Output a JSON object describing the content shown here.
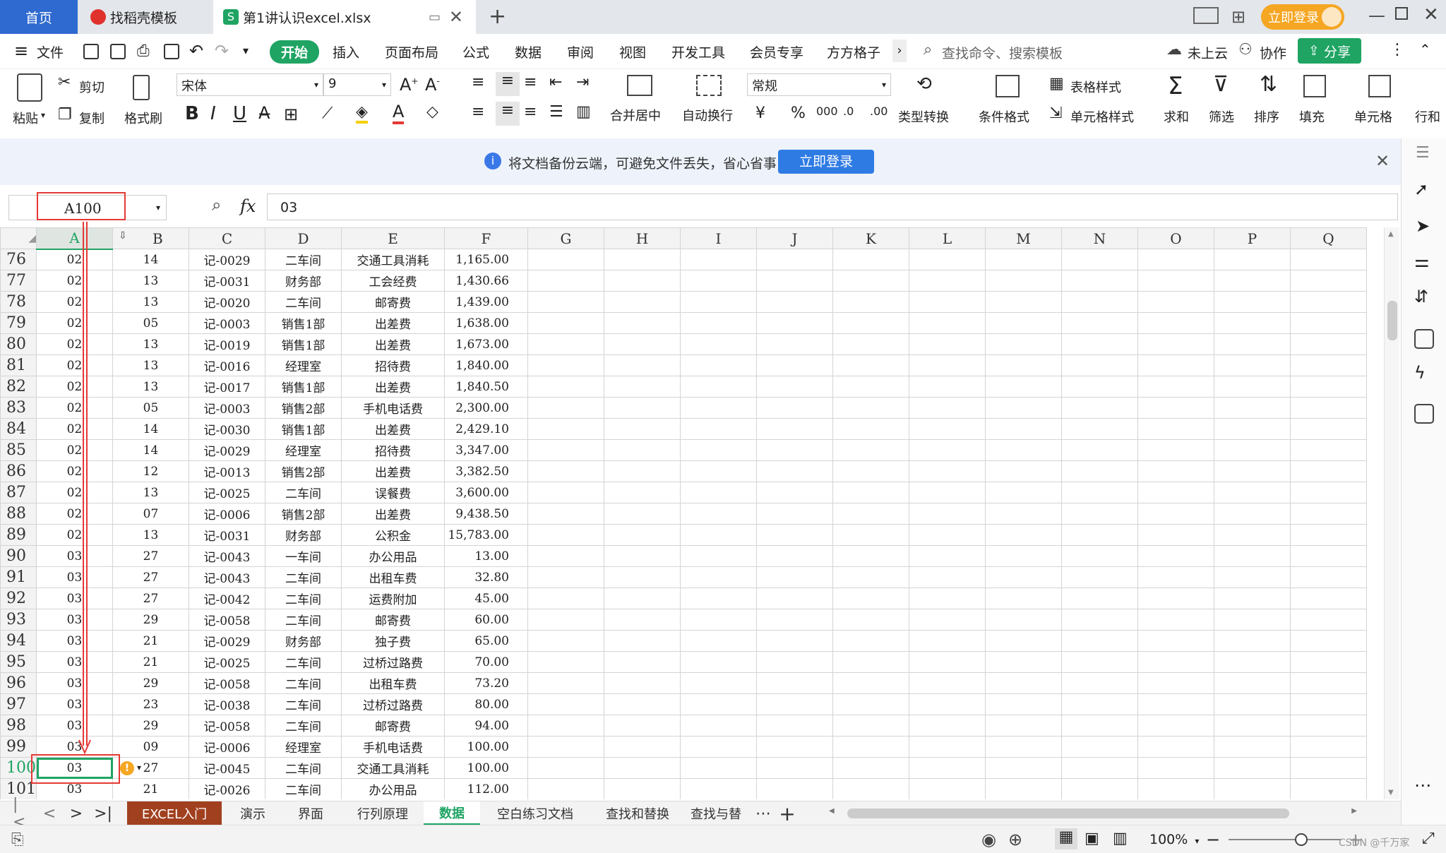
{
  "tabs": {
    "home": "首页",
    "template": "找稻壳模板",
    "file": "第1讲认识excel.xlsx",
    "login": "立即登录"
  },
  "menu": {
    "file": "文件",
    "items": [
      "开始",
      "插入",
      "页面布局",
      "公式",
      "数据",
      "审阅",
      "视图",
      "开发工具",
      "会员专享",
      "方方格子"
    ],
    "search_placeholder": "查找命令、搜索模板",
    "cloud": "未上云",
    "collab": "协作",
    "share": "分享"
  },
  "toolbar": {
    "paste": "粘贴",
    "cut": "剪切",
    "copy": "复制",
    "format_painter": "格式刷",
    "font_name": "宋体",
    "font_size": "9",
    "merge_center": "合并居中",
    "wrap": "自动换行",
    "number_format": "常规",
    "type_convert": "类型转换",
    "cond_format": "条件格式",
    "table_style": "表格样式",
    "cell_style": "单元格样式",
    "sum": "求和",
    "filter": "筛选",
    "sort": "排序",
    "fill": "填充",
    "cell": "单元格",
    "rowcol": "行和"
  },
  "notice": {
    "text": "将文档备份云端，可避免文件丢失，省心省事",
    "button": "立即登录"
  },
  "formula_bar": {
    "name_box": "A100",
    "fx": "fx",
    "value": "03"
  },
  "columns": [
    "A",
    "B",
    "C",
    "D",
    "E",
    "F",
    "G",
    "H",
    "I",
    "J",
    "K",
    "L",
    "M",
    "N",
    "O",
    "P",
    "Q"
  ],
  "rows": [
    {
      "n": "76",
      "a": "02",
      "b": "14",
      "c": "记-0029",
      "d": "二车间",
      "e": "交通工具消耗",
      "f": "1,165.00"
    },
    {
      "n": "77",
      "a": "02",
      "b": "13",
      "c": "记-0031",
      "d": "财务部",
      "e": "工会经费",
      "f": "1,430.66"
    },
    {
      "n": "78",
      "a": "02",
      "b": "13",
      "c": "记-0020",
      "d": "二车间",
      "e": "邮寄费",
      "f": "1,439.00"
    },
    {
      "n": "79",
      "a": "02",
      "b": "05",
      "c": "记-0003",
      "d": "销售1部",
      "e": "出差费",
      "f": "1,638.00"
    },
    {
      "n": "80",
      "a": "02",
      "b": "13",
      "c": "记-0019",
      "d": "销售1部",
      "e": "出差费",
      "f": "1,673.00"
    },
    {
      "n": "81",
      "a": "02",
      "b": "13",
      "c": "记-0016",
      "d": "经理室",
      "e": "招待费",
      "f": "1,840.00"
    },
    {
      "n": "82",
      "a": "02",
      "b": "13",
      "c": "记-0017",
      "d": "销售1部",
      "e": "出差费",
      "f": "1,840.50"
    },
    {
      "n": "83",
      "a": "02",
      "b": "05",
      "c": "记-0003",
      "d": "销售2部",
      "e": "手机电话费",
      "f": "2,300.00"
    },
    {
      "n": "84",
      "a": "02",
      "b": "14",
      "c": "记-0030",
      "d": "销售1部",
      "e": "出差费",
      "f": "2,429.10"
    },
    {
      "n": "85",
      "a": "02",
      "b": "14",
      "c": "记-0029",
      "d": "经理室",
      "e": "招待费",
      "f": "3,347.00"
    },
    {
      "n": "86",
      "a": "02",
      "b": "12",
      "c": "记-0013",
      "d": "销售2部",
      "e": "出差费",
      "f": "3,382.50"
    },
    {
      "n": "87",
      "a": "02",
      "b": "13",
      "c": "记-0025",
      "d": "二车间",
      "e": "误餐费",
      "f": "3,600.00"
    },
    {
      "n": "88",
      "a": "02",
      "b": "07",
      "c": "记-0006",
      "d": "销售2部",
      "e": "出差费",
      "f": "9,438.50"
    },
    {
      "n": "89",
      "a": "02",
      "b": "13",
      "c": "记-0031",
      "d": "财务部",
      "e": "公积金",
      "f": "15,783.00"
    },
    {
      "n": "90",
      "a": "03",
      "b": "27",
      "c": "记-0043",
      "d": "一车间",
      "e": "办公用品",
      "f": "13.00"
    },
    {
      "n": "91",
      "a": "03",
      "b": "27",
      "c": "记-0043",
      "d": "二车间",
      "e": "出租车费",
      "f": "32.80"
    },
    {
      "n": "92",
      "a": "03",
      "b": "27",
      "c": "记-0042",
      "d": "二车间",
      "e": "运费附加",
      "f": "45.00"
    },
    {
      "n": "93",
      "a": "03",
      "b": "29",
      "c": "记-0058",
      "d": "二车间",
      "e": "邮寄费",
      "f": "60.00"
    },
    {
      "n": "94",
      "a": "03",
      "b": "21",
      "c": "记-0029",
      "d": "财务部",
      "e": "独子费",
      "f": "65.00"
    },
    {
      "n": "95",
      "a": "03",
      "b": "21",
      "c": "记-0025",
      "d": "二车间",
      "e": "过桥过路费",
      "f": "70.00"
    },
    {
      "n": "96",
      "a": "03",
      "b": "29",
      "c": "记-0058",
      "d": "二车间",
      "e": "出租车费",
      "f": "73.20"
    },
    {
      "n": "97",
      "a": "03",
      "b": "23",
      "c": "记-0038",
      "d": "二车间",
      "e": "过桥过路费",
      "f": "80.00"
    },
    {
      "n": "98",
      "a": "03",
      "b": "29",
      "c": "记-0058",
      "d": "二车间",
      "e": "邮寄费",
      "f": "94.00"
    },
    {
      "n": "99",
      "a": "03",
      "b": "09",
      "c": "记-0006",
      "d": "经理室",
      "e": "手机电话费",
      "f": "100.00"
    },
    {
      "n": "100",
      "a": "03",
      "b": "27",
      "c": "记-0045",
      "d": "二车间",
      "e": "交通工具消耗",
      "f": "100.00"
    },
    {
      "n": "101",
      "a": "03",
      "b": "21",
      "c": "记-0026",
      "d": "二车间",
      "e": "办公用品",
      "f": "112.00"
    }
  ],
  "sheet_tabs": [
    "EXCEL入门",
    "演示",
    "界面",
    "行列原理",
    "数据",
    "空白练习文档",
    "查找和替换",
    "查找与替"
  ],
  "active_sheet": "数据",
  "status": {
    "zoom": "100%",
    "watermark": "CSDN @千万家"
  },
  "colors": {
    "accent": "#1fa463",
    "home_tab": "#2f6ad0",
    "login_btn": "#f5a623",
    "first_sheet_tab": "#a0401f",
    "annotation": "#e53935"
  }
}
